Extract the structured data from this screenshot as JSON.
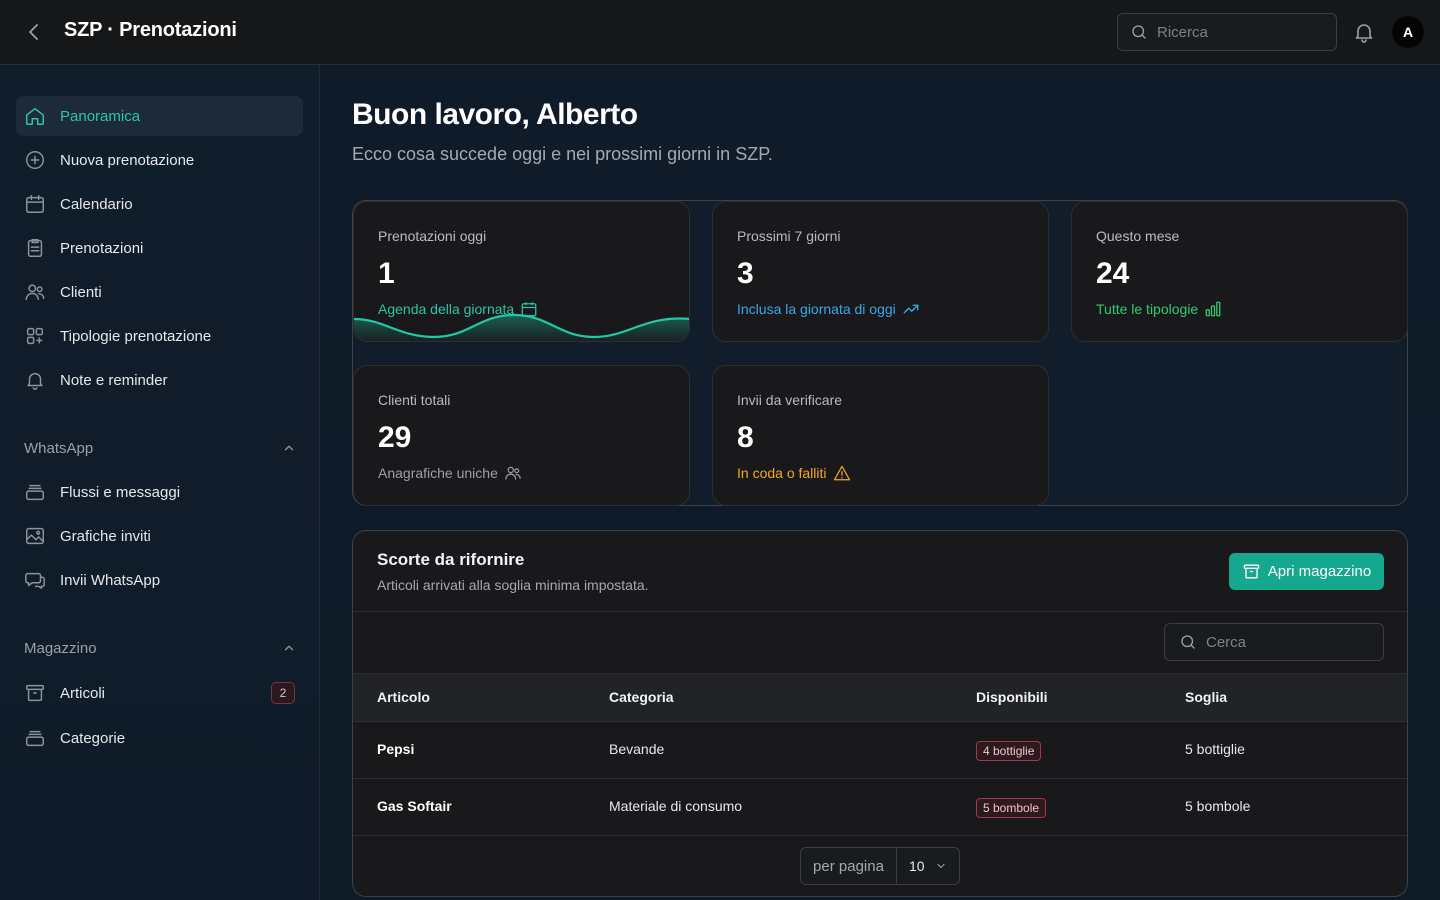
{
  "header": {
    "title": "SZP · Prenotazioni",
    "search_placeholder": "Ricerca",
    "avatar_initial": "A"
  },
  "sidebar": {
    "items": [
      {
        "label": "Panoramica",
        "icon": "home-icon",
        "active": true
      },
      {
        "label": "Nuova prenotazione",
        "icon": "plus-circle-icon"
      },
      {
        "label": "Calendario",
        "icon": "calendar-icon"
      },
      {
        "label": "Prenotazioni",
        "icon": "clipboard-icon"
      },
      {
        "label": "Clienti",
        "icon": "users-icon"
      },
      {
        "label": "Tipologie prenotazione",
        "icon": "grid-icon"
      },
      {
        "label": "Note e reminder",
        "icon": "bell-icon"
      }
    ],
    "whatsapp": {
      "title": "WhatsApp",
      "items": [
        {
          "label": "Flussi e messaggi",
          "icon": "layers-icon"
        },
        {
          "label": "Grafiche inviti",
          "icon": "image-icon"
        },
        {
          "label": "Invii WhatsApp",
          "icon": "chat-icon"
        }
      ]
    },
    "magazzino": {
      "title": "Magazzino",
      "items": [
        {
          "label": "Articoli",
          "icon": "archive-icon",
          "badge": "2"
        },
        {
          "label": "Categorie",
          "icon": "layers-icon"
        }
      ]
    }
  },
  "main": {
    "greeting": "Buon lavoro, Alberto",
    "subtitle": "Ecco cosa succede oggi e nei prossimi giorni in SZP.",
    "stats": [
      {
        "label": "Prenotazioni oggi",
        "value": "1",
        "foot": "Agenda della giornata",
        "foot_color": "#2ec4a6",
        "icon": "calendar-icon"
      },
      {
        "label": "Prossimi 7 giorni",
        "value": "3",
        "foot": "Inclusa la giornata di oggi",
        "foot_color": "#38a8e8",
        "icon": "trending-up-icon"
      },
      {
        "label": "Questo mese",
        "value": "24",
        "foot": "Tutte le tipologie",
        "foot_color": "#2ecc71",
        "icon": "bar-chart-icon"
      },
      {
        "label": "Clienti totali",
        "value": "29",
        "foot": "Anagrafiche uniche",
        "foot_color": "#9aa0a6",
        "icon": "users-icon"
      },
      {
        "label": "Invii da verificare",
        "value": "8",
        "foot": "In coda o falliti",
        "foot_color": "#f5a623",
        "icon": "warning-icon"
      }
    ],
    "stock": {
      "title": "Scorte da rifornire",
      "subtitle": "Articoli arrivati alla soglia minima impostata.",
      "open_button": "Apri magazzino",
      "search_placeholder": "Cerca",
      "columns": [
        "Articolo",
        "Categoria",
        "Disponibili",
        "Soglia"
      ],
      "rows": [
        {
          "articolo": "Pepsi",
          "categoria": "Bevande",
          "disponibili": "4 bottiglie",
          "soglia": "5 bottiglie"
        },
        {
          "articolo": "Gas Softair",
          "categoria": "Materiale di consumo",
          "disponibili": "5 bombole",
          "soglia": "5 bombole"
        }
      ],
      "pager": {
        "label": "per pagina",
        "value": "10"
      }
    }
  }
}
